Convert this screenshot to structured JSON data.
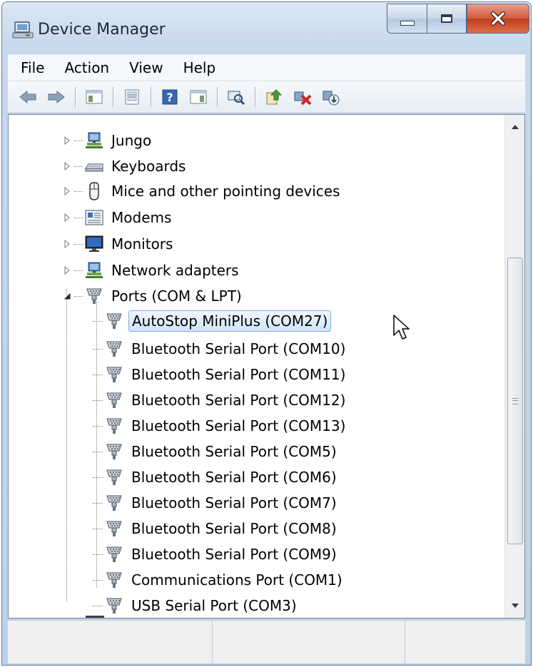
{
  "window": {
    "title": "Device Manager"
  },
  "menu": [
    "File",
    "Action",
    "View",
    "Help"
  ],
  "toolbar": {
    "icons": [
      "back-arrow-icon",
      "forward-arrow-icon",
      "console-tree-icon",
      "properties-icon",
      "help-icon",
      "action-pane-icon",
      "scan-hardware-icon",
      "update-driver-icon",
      "disable-device-icon",
      "uninstall-device-icon"
    ]
  },
  "tree": {
    "categories": [
      {
        "label": "Jungo",
        "icon": "network-device-icon",
        "expanded": false
      },
      {
        "label": "Keyboards",
        "icon": "keyboard-icon",
        "expanded": false
      },
      {
        "label": "Mice and other pointing devices",
        "icon": "mouse-icon",
        "expanded": false
      },
      {
        "label": "Modems",
        "icon": "modem-icon",
        "expanded": false
      },
      {
        "label": "Monitors",
        "icon": "monitor-icon",
        "expanded": false
      },
      {
        "label": "Network adapters",
        "icon": "network-adapter-icon",
        "expanded": false
      },
      {
        "label": "Ports (COM & LPT)",
        "icon": "port-icon",
        "expanded": true
      }
    ],
    "ports": [
      {
        "label": "AutoStop MiniPlus (COM27)",
        "selected": true
      },
      {
        "label": "Bluetooth Serial Port (COM10)"
      },
      {
        "label": "Bluetooth Serial Port (COM11)"
      },
      {
        "label": "Bluetooth Serial Port (COM12)"
      },
      {
        "label": "Bluetooth Serial Port (COM13)"
      },
      {
        "label": "Bluetooth Serial Port (COM5)"
      },
      {
        "label": "Bluetooth Serial Port (COM6)"
      },
      {
        "label": "Bluetooth Serial Port (COM7)"
      },
      {
        "label": "Bluetooth Serial Port (COM8)"
      },
      {
        "label": "Bluetooth Serial Port (COM9)"
      },
      {
        "label": "Communications Port (COM1)"
      },
      {
        "label": "USB Serial Port (COM3)"
      }
    ]
  },
  "colors": {
    "selection_border": "#84acdd",
    "close_button": "#c23c1c",
    "frame": "#bcd0e8"
  }
}
